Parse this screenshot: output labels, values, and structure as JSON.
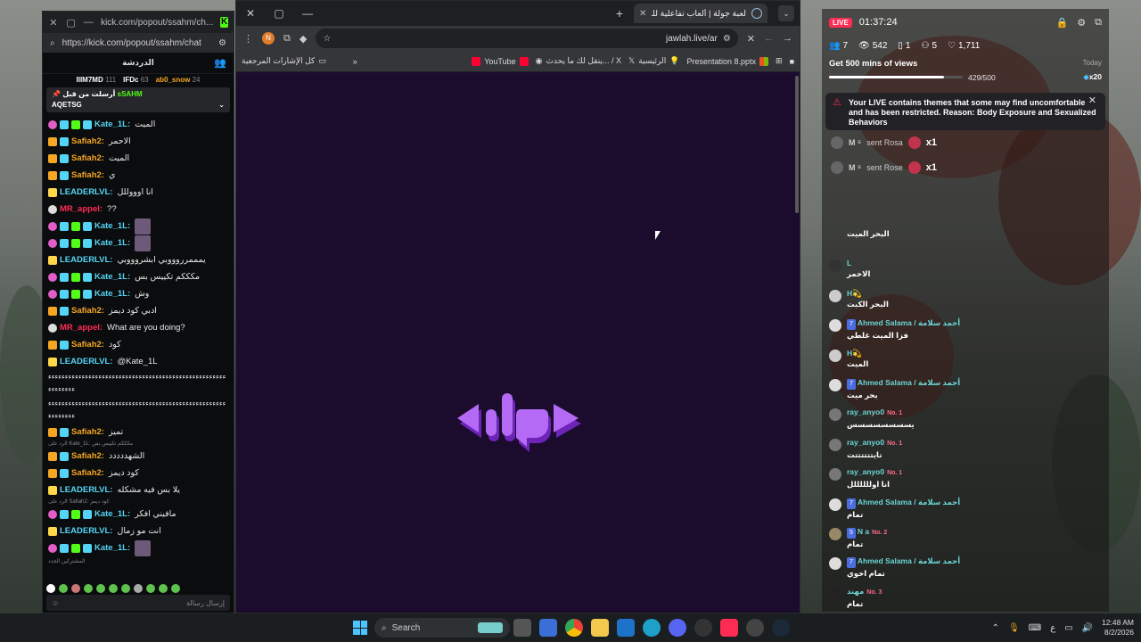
{
  "kick": {
    "url": "https://kick.com/popout/ssahm/chat",
    "title_url": "kick.com/popout/ssahm/ch...",
    "chat_title": "الدردشة",
    "top_gifters": [
      {
        "name": "IIIM7MD",
        "count": "111"
      },
      {
        "name": "IFDc",
        "count": "63"
      },
      {
        "name": "ab0_snow",
        "count": "24"
      }
    ],
    "pinned_by": "أرسلت من قبل",
    "pinned_user": "sSAHM",
    "pinned_text": "AQETSG",
    "messages": [
      {
        "user": "Kate_1L:",
        "text": "الميت",
        "color": "#54d5f5",
        "badges": [
          "sub",
          "vip",
          "grn",
          "vip"
        ]
      },
      {
        "user": "Safiah2:",
        "text": "الاحمر",
        "color": "#f5a623",
        "badges": [
          "crown",
          "vip"
        ]
      },
      {
        "user": "Safiah2:",
        "text": "الميت",
        "color": "#f5a623",
        "badges": [
          "crown",
          "vip"
        ]
      },
      {
        "user": "Safiah2:",
        "text": "ي",
        "color": "#f5a623",
        "badges": [
          "crown",
          "vip"
        ]
      },
      {
        "user": "LEADERLVL:",
        "text": "انا اوووللل",
        "color": "#54d5f5",
        "badges": [
          "lvl"
        ]
      },
      {
        "user": "MR_appel:",
        "text": "??",
        "color": "#fe2c55",
        "badges": [
          "q"
        ]
      },
      {
        "user": "Kate_1L:",
        "text": "",
        "color": "#54d5f5",
        "badges": [
          "sub",
          "vip",
          "grn",
          "vip"
        ],
        "emote": true
      },
      {
        "user": "Kate_1L:",
        "text": "",
        "color": "#54d5f5",
        "badges": [
          "sub",
          "vip",
          "grn",
          "vip"
        ],
        "emote": true
      },
      {
        "user": "LEADERLVL:",
        "text": "يمممرروووبي ابشروووبي",
        "color": "#54d5f5",
        "badges": [
          "lvl"
        ]
      },
      {
        "user": "Kate_1L:",
        "text": "مكككم تكييس بس",
        "color": "#54d5f5",
        "badges": [
          "sub",
          "vip",
          "grn",
          "vip"
        ]
      },
      {
        "user": "Kate_1L:",
        "text": "وش",
        "color": "#54d5f5",
        "badges": [
          "sub",
          "vip",
          "grn",
          "vip"
        ]
      },
      {
        "user": "Safiah2:",
        "text": "ادبي كود ديمز",
        "color": "#f5a623",
        "badges": [
          "crown",
          "vip"
        ]
      },
      {
        "user": "MR_appel:",
        "text": "What are you doing?",
        "color": "#fe2c55",
        "badges": [
          "q"
        ]
      },
      {
        "user": "Safiah2:",
        "text": "كود",
        "color": "#f5a623",
        "badges": [
          "crown",
          "vip"
        ]
      },
      {
        "user": "LEADERLVL:",
        "text": "@Kate_1L",
        "color": "#54d5f5",
        "badges": [
          "lvl"
        ]
      }
    ],
    "spam_lines": [
      "ءءءءءءءءءءءءءءءءءءءءءءءءءءءءءءءءءءءءءءءءءءءءءءءءءءءءءءءءءءءءء",
      "ءءءءءءءءءءءءءءءءءءءءءءءءءءءءءءءءءءءءءءءءءءءءءءءءءءءءءءءءءءءءء"
    ],
    "messages2": [
      {
        "user": "Safiah2:",
        "text": "تميز",
        "color": "#f5a623",
        "badges": [
          "crown",
          "vip"
        ]
      },
      {
        "user": "Safiah2:",
        "text": "الشهددددد",
        "color": "#f5a623",
        "badges": [
          "crown",
          "vip"
        ],
        "reply": "الرد على Kate_1L: مكككم تكييس بس"
      },
      {
        "user": "Safiah2:",
        "text": "كود ديمز",
        "color": "#f5a623",
        "badges": [
          "crown",
          "vip"
        ]
      },
      {
        "user": "LEADERLVL:",
        "text": "يلا بس فيه مشكله",
        "color": "#54d5f5",
        "badges": [
          "lvl"
        ]
      },
      {
        "user": "Kate_1L:",
        "text": "مافيني افكر",
        "color": "#54d5f5",
        "badges": [
          "sub",
          "vip",
          "grn",
          "vip"
        ],
        "reply": "الرد على Safiah2: كود ديمز"
      },
      {
        "user": "LEADERLVL:",
        "text": "انت مو زمال",
        "color": "#54d5f5",
        "badges": [
          "lvl"
        ]
      },
      {
        "user": "Kate_1L:",
        "text": "",
        "color": "#54d5f5",
        "badges": [
          "sub",
          "vip",
          "grn",
          "vip"
        ],
        "emote": true
      }
    ],
    "send_placeholder": "إرسال رسالة",
    "recent_label": "المشتركين الجدد"
  },
  "browser": {
    "tab_title": "لعبة جولة | ألعاب تفاعلية للبث الـ...",
    "address": "jawlah.live/ar",
    "profile_initial": "N",
    "bookmarks": [
      {
        "label": "",
        "icon_color": "#aaa"
      },
      {
        "label": "Presentation 8.pptx",
        "icon_color": "#d2502e"
      },
      {
        "label": "الرئيسية",
        "icon_color": "#f5c542"
      },
      {
        "label": "ينقل لك ما يحدث... / X",
        "icon_color": "#ffffff"
      },
      {
        "label": "",
        "icon_color": "#ddd"
      },
      {
        "label": "YouTube",
        "icon_color": "#ff0033"
      },
      {
        "label": "",
        "icon_color": "#ff0033"
      }
    ],
    "bookmark_overflow": "»",
    "all_bookmarks": "كل الإشارات المرجعية"
  },
  "live": {
    "badge": "LIVE",
    "time": "01:37:24",
    "stats": [
      {
        "icon": "users-icon",
        "glyph": "👥",
        "value": "7"
      },
      {
        "icon": "eye-icon",
        "glyph": "👁",
        "value": "542"
      },
      {
        "icon": "tablet-icon",
        "glyph": "▯",
        "value": "1"
      },
      {
        "icon": "share-icon",
        "glyph": "⚇",
        "value": "5"
      },
      {
        "icon": "heart-icon",
        "glyph": "♡",
        "value": "1,711"
      }
    ],
    "goal_title": "Get 500 mins of views",
    "goal_today": "Today",
    "goal_progress": "429/500",
    "goal_fraction": 0.858,
    "goal_mult": "x20",
    "warning": "Your LIVE contains themes that some may find uncomfortable and has been restricted. Reason: Body Exposure and Sexualized Behaviors",
    "gifts": [
      {
        "sender": "M ⁵",
        "text": "sent Rosa",
        "count": "x1"
      },
      {
        "sender": "M ⁵",
        "text": "sent Rose",
        "count": "x1"
      }
    ],
    "chat": [
      {
        "name": "",
        "sub": "",
        "tag": "",
        "text": "البحر الميت",
        "avatar": "none"
      },
      {
        "name": "L",
        "sub": "",
        "tag": "",
        "text": "الاحمر",
        "avatar": "#333"
      },
      {
        "name": "H💫",
        "sub": "",
        "tag": "",
        "text": "البحر الكبت",
        "avatar": "#ccc"
      },
      {
        "name": "Ahmed Salama / أحمد سلامة",
        "sub": "",
        "tag": "7",
        "text": "فزا الميت غلطي",
        "avatar": "#ddd"
      },
      {
        "name": "H💫",
        "sub": "",
        "tag": "",
        "text": "الميت",
        "avatar": "#ccc"
      },
      {
        "name": "Ahmed Salama / أحمد سلامة",
        "sub": "",
        "tag": "7",
        "text": "بحر ميت",
        "avatar": "#ddd"
      },
      {
        "name": "ray_anyo0",
        "sub": "No. 1",
        "tag": "",
        "text": "يسسسسسسسس",
        "avatar": "#777"
      },
      {
        "name": "ray_anyo0",
        "sub": "No. 1",
        "tag": "",
        "text": "تايتتتتتتت",
        "avatar": "#777"
      },
      {
        "name": "ray_anyo0",
        "sub": "No. 1",
        "tag": "",
        "text": "انا اوللللللل",
        "avatar": "#777"
      },
      {
        "name": "Ahmed Salama / أحمد سلامة",
        "sub": "",
        "tag": "7",
        "text": "تمام",
        "avatar": "#ddd"
      },
      {
        "name": "N a",
        "sub": "No. 2",
        "tag": "5",
        "text": "تمام",
        "avatar": "#998866"
      },
      {
        "name": "Ahmed Salama / أحمد سلامة",
        "sub": "",
        "tag": "7",
        "text": "تمام اخوي",
        "avatar": "#ddd"
      },
      {
        "name": "مهند",
        "sub": "No. 3",
        "tag": "",
        "text": "تمام",
        "avatar": "#222"
      }
    ]
  },
  "taskbar": {
    "search_label": "Search",
    "time": "12:48 AM",
    "date": "8/2/2026",
    "lang": "ع"
  }
}
